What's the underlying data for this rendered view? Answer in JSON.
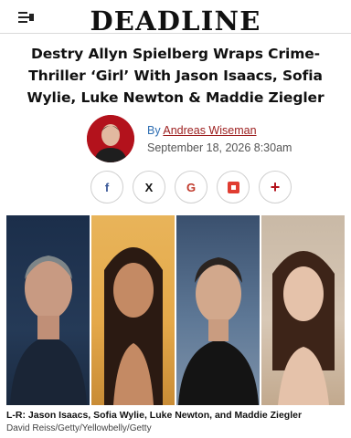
{
  "header": {
    "logo": "DEADLINE",
    "menu_icon": "menu-icon"
  },
  "article": {
    "headline": "Destry Allyn Spielberg Wraps Crime-Thriller ‘Girl’ With Jason Isaacs, Sofia Wylie, Luke Newton & Maddie Ziegler",
    "by_prefix": "By",
    "author": "Andreas Wiseman",
    "date": "September 18, 2026 8:30am"
  },
  "share": {
    "facebook": "f",
    "x": "X",
    "gmail": "G",
    "more": "+"
  },
  "photo": {
    "caption": "L-R: Jason Isaacs, Sofia Wylie, Luke Newton, and Maddie Ziegler",
    "credit": "David Reiss/Getty/Yellowbelly/Getty"
  },
  "colors": {
    "accent": "#b3121c",
    "link": "#2f6fb3",
    "author": "#9b1b1b"
  }
}
